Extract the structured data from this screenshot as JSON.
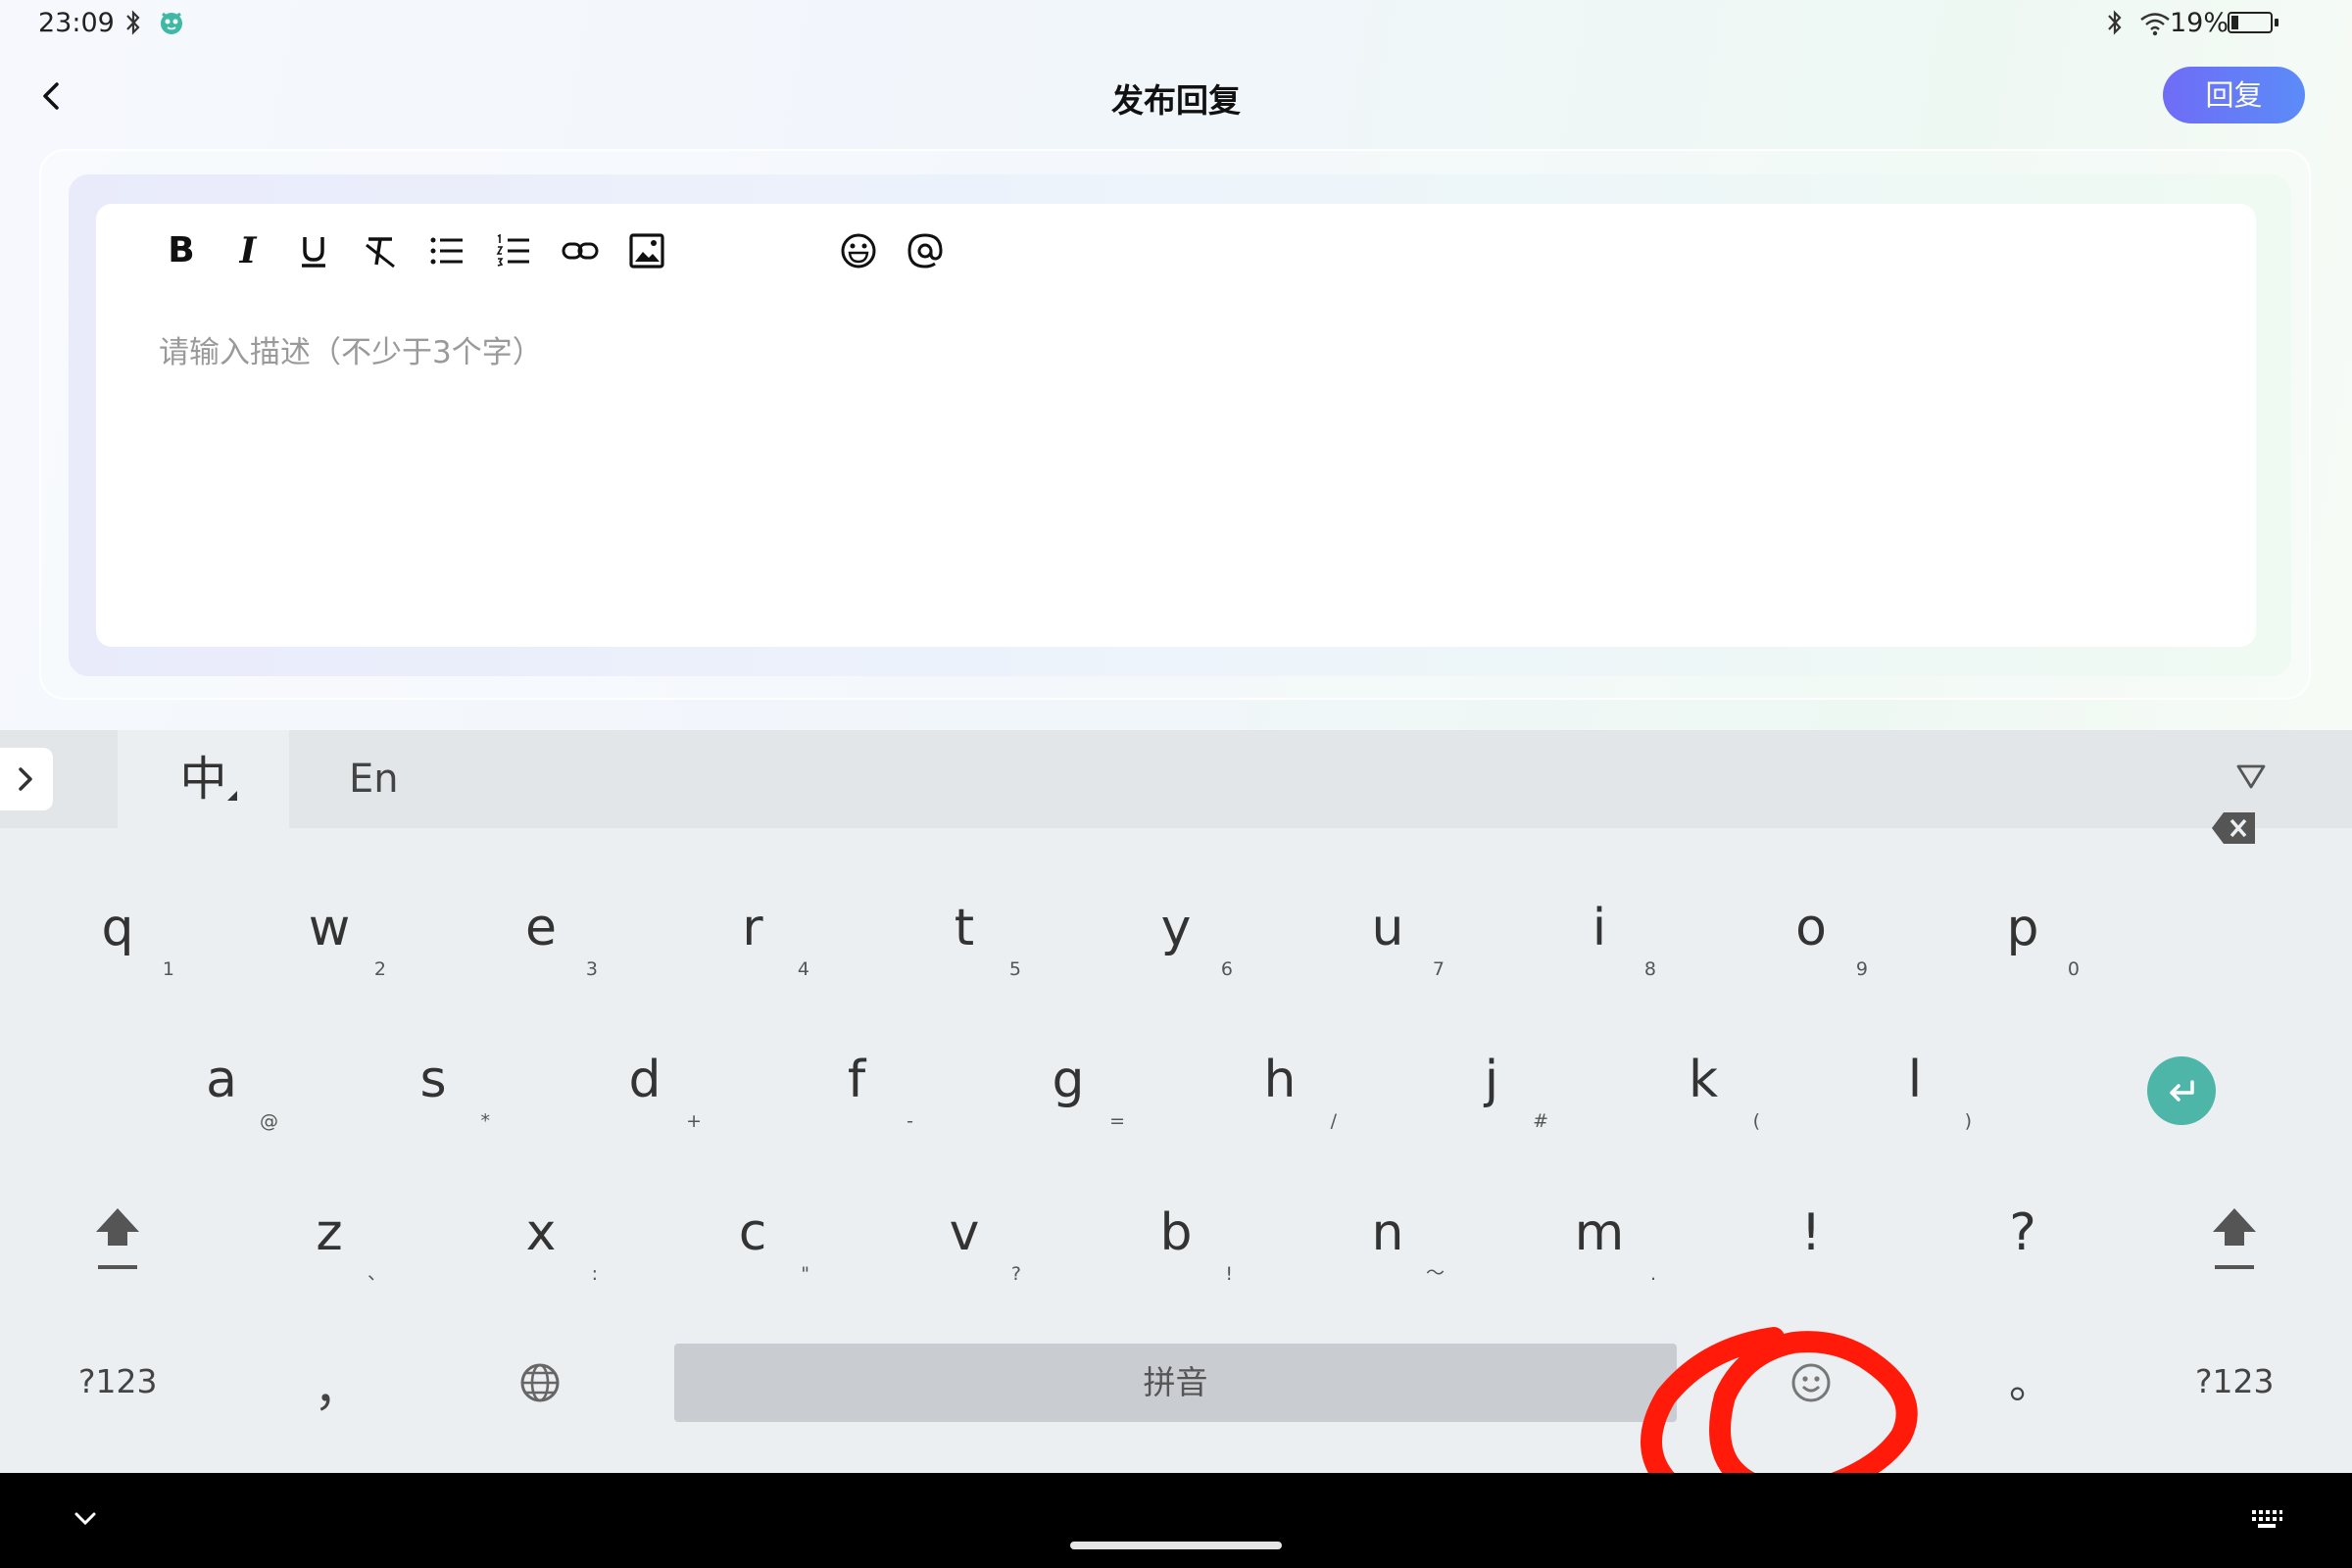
{
  "status_bar": {
    "time": "23:09",
    "battery_text": "19%",
    "battery_level": 0.19
  },
  "header": {
    "title": "发布回复",
    "reply_label": "回复"
  },
  "editor": {
    "toolbar": [
      {
        "name": "bold",
        "icon": "bold-icon"
      },
      {
        "name": "italic",
        "icon": "italic-icon"
      },
      {
        "name": "underline",
        "icon": "underline-icon"
      },
      {
        "name": "clear-format",
        "icon": "clear-format-icon"
      },
      {
        "name": "bullet-list",
        "icon": "bullet-list-icon"
      },
      {
        "name": "numbered-list",
        "icon": "numbered-list-icon"
      },
      {
        "name": "link",
        "icon": "link-icon"
      },
      {
        "name": "image",
        "icon": "image-icon"
      },
      {
        "name": "emoji",
        "icon": "emoji-icon"
      },
      {
        "name": "mention",
        "icon": "at-icon"
      }
    ],
    "placeholder": "请输入描述（不少于3个字）"
  },
  "keyboard": {
    "tab_zh": "中",
    "tab_en": "En",
    "row1": [
      {
        "ch": "q",
        "sub": "1"
      },
      {
        "ch": "w",
        "sub": "2"
      },
      {
        "ch": "e",
        "sub": "3"
      },
      {
        "ch": "r",
        "sub": "4"
      },
      {
        "ch": "t",
        "sub": "5"
      },
      {
        "ch": "y",
        "sub": "6"
      },
      {
        "ch": "u",
        "sub": "7"
      },
      {
        "ch": "i",
        "sub": "8"
      },
      {
        "ch": "o",
        "sub": "9"
      },
      {
        "ch": "p",
        "sub": "0"
      }
    ],
    "row2": [
      {
        "ch": "a",
        "sub": "@"
      },
      {
        "ch": "s",
        "sub": "*"
      },
      {
        "ch": "d",
        "sub": "+"
      },
      {
        "ch": "f",
        "sub": "-"
      },
      {
        "ch": "g",
        "sub": "="
      },
      {
        "ch": "h",
        "sub": "/"
      },
      {
        "ch": "j",
        "sub": "#"
      },
      {
        "ch": "k",
        "sub": "("
      },
      {
        "ch": "l",
        "sub": ")"
      }
    ],
    "row3": [
      {
        "ch": "z",
        "sub": "、"
      },
      {
        "ch": "x",
        "sub": ":"
      },
      {
        "ch": "c",
        "sub": "\""
      },
      {
        "ch": "v",
        "sub": "?"
      },
      {
        "ch": "b",
        "sub": "!"
      },
      {
        "ch": "n",
        "sub": "～"
      },
      {
        "ch": "m",
        "sub": "."
      },
      {
        "ch": "!",
        "sub": ""
      },
      {
        "ch": "?",
        "sub": ""
      }
    ],
    "fn_left": "?123",
    "comma": "，",
    "space_label": "拼音",
    "period": "。",
    "fn_right": "?123"
  },
  "colors": {
    "accent": "#6f6cf6",
    "enter": "#4db6a8",
    "annotation": "#ff1a0a"
  }
}
